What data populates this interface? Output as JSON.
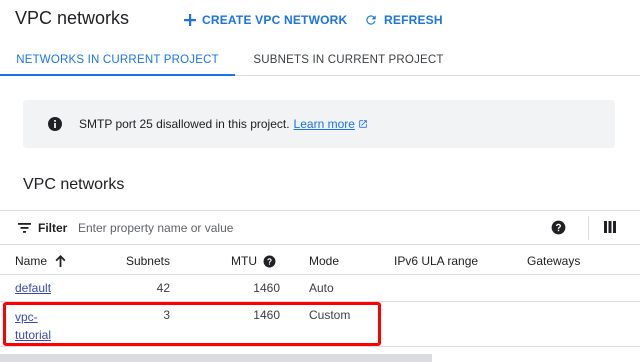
{
  "header": {
    "title": "VPC networks",
    "create_label": "CREATE VPC NETWORK",
    "refresh_label": "REFRESH"
  },
  "tabs": [
    {
      "label": "NETWORKS IN CURRENT PROJECT",
      "active": true
    },
    {
      "label": "SUBNETS IN CURRENT PROJECT",
      "active": false
    }
  ],
  "banner": {
    "text": "SMTP port 25 disallowed in this project.",
    "link": "Learn more"
  },
  "section": {
    "title": "VPC networks"
  },
  "filter": {
    "label": "Filter",
    "placeholder": "Enter property name or value",
    "value": ""
  },
  "table": {
    "columns": [
      "Name",
      "Subnets",
      "MTU",
      "Mode",
      "IPv6 ULA range",
      "Gateways"
    ],
    "sort_column": "Name",
    "sort_direction": "ascending",
    "rows": [
      {
        "name": "default",
        "subnets": "42",
        "mtu": "1460",
        "mode": "Auto",
        "ipv6": "",
        "gateways": ""
      },
      {
        "name_line1": "vpc-",
        "name_line2": "tutorial",
        "subnets": "3",
        "mtu": "1460",
        "mode": "Custom",
        "ipv6": "",
        "gateways": ""
      }
    ]
  },
  "colors": {
    "accent": "#1a73e8",
    "highlight": "#ff0000",
    "banner_bg": "#f1f3f4"
  },
  "icons": [
    "plus-icon",
    "refresh-icon",
    "info-icon",
    "external-link-icon",
    "filter-icon",
    "help-icon",
    "columns-icon",
    "arrow-up-icon"
  ]
}
